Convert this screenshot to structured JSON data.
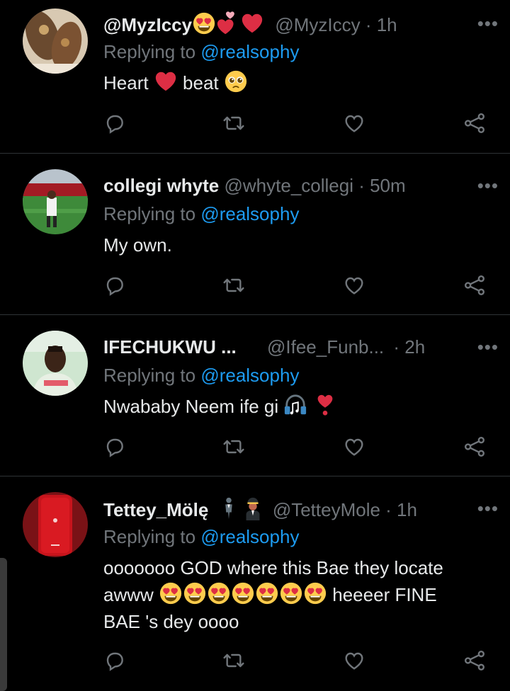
{
  "replies": [
    {
      "name": "@MyzIccy",
      "handle": "@MyzIccy",
      "time": "· 1h",
      "replying_prefix": "Replying to",
      "mention": "@realsophy",
      "text_part1": "Heart",
      "text_part2": "beat"
    },
    {
      "name": "collegi whyte",
      "handle": "@whyte_collegi",
      "time": "· 50m",
      "replying_prefix": "Replying to",
      "mention": "@realsophy",
      "text": "My own."
    },
    {
      "name": "IFECHUKWU ...",
      "handle": "@Ifee_Funb...",
      "time": "· 2h",
      "replying_prefix": "Replying to",
      "mention": "@realsophy",
      "text": "Nwababy Neem ife gi"
    },
    {
      "name": "Tettey_Mölę",
      "handle": "@TetteyMole",
      "time": "· 1h",
      "replying_prefix": "Replying to",
      "mention": "@realsophy",
      "text_line1": "ooooooo GOD where this Bae they locate",
      "text_line2a": "awww",
      "text_line2b": "heeeer FINE",
      "text_line3": "BAE 's dey oooo"
    }
  ],
  "more_label": "•••",
  "icons": [
    "reply-icon",
    "retweet-icon",
    "like-icon",
    "share-icon"
  ],
  "colors": {
    "background": "#000000",
    "text": "#e7e9ea",
    "muted": "#71767b",
    "link": "#1d9bf0",
    "divider": "#2f3336"
  }
}
